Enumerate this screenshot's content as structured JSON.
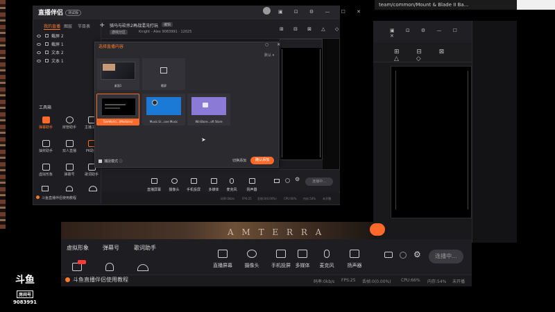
{
  "background": {
    "address_text": "team/common/Mount & Blade II Ba...",
    "banner_text": "A M T E R R A"
  },
  "back_window": {
    "tools_left": [
      "虚拟形象",
      "弹幕号",
      "歌词助手"
    ],
    "toolbar": [
      {
        "label": "直播屏幕",
        "icon": "screen-icon"
      },
      {
        "label": "摄像头",
        "icon": "camera-icon"
      },
      {
        "label": "手机投屏",
        "icon": "phone-icon"
      },
      {
        "label": "多媒体",
        "icon": "media-icon"
      },
      {
        "label": "麦克风",
        "icon": "mic-icon"
      },
      {
        "label": "扬声器",
        "icon": "speaker-icon"
      }
    ],
    "live_button": "连播中...",
    "notice": "斗鱼直播伴侣使用教程",
    "status": {
      "bitrate": "码率:0kb/s",
      "fps": "FPS:25",
      "dropped": "丢帧:0(0.00%)",
      "cpu": "CPU:66%",
      "memory": "内存:54%",
      "extra": "未开播"
    }
  },
  "main_window": {
    "logo": "直播伴侣",
    "version_badge": "测试版",
    "left_tabs": [
      "我的直播",
      "图层",
      "节目表"
    ],
    "layers": [
      {
        "name": "截屏 2"
      },
      {
        "name": "截屏 1"
      },
      {
        "name": "文本 2"
      },
      {
        "name": "文本 1"
      }
    ],
    "tools_title": "工具箱",
    "tools": [
      {
        "label": "弹幕助手",
        "active": true
      },
      {
        "label": "房管助手",
        "active": false
      },
      {
        "label": "主播工具",
        "active": false
      },
      {
        "label": "抽奖助手",
        "active": false
      },
      {
        "label": "双人直播",
        "active": false
      },
      {
        "label": "PK助手",
        "active": false
      },
      {
        "label": "虚拟形象",
        "active": false
      },
      {
        "label": "弹幕号",
        "active": false
      },
      {
        "label": "歌词助手",
        "active": false
      }
    ],
    "room_title": "骑马与砍杀2再战混沌打玩",
    "edit_tag": "编辑",
    "room_tag": "游戏分区",
    "room_meta": "Knight - Alex 9083991 · 12025",
    "bottom_tools": [
      "直播屏幕",
      "摄像头",
      "手机投屏",
      "多媒体",
      "麦克风",
      "扬声器"
    ],
    "live_button": "连播中...",
    "notice": "斗鱼直播伴侣使用教程",
    "status": [
      "码率:0kb/s",
      "FPS:25",
      "丢帧:0(0.00%)",
      "CPU:66%",
      "内存:54%",
      "未开播"
    ]
  },
  "modal": {
    "title": "选择直播内容",
    "filter_label": "默认",
    "sources": [
      {
        "name": "桌面1",
        "selected": false,
        "thumb": "dark"
      },
      {
        "name": "截屏",
        "selected": false,
        "thumb": "icon"
      },
      {
        "name": "TaleWorld...(Modules)",
        "selected": true,
        "thumb": "black"
      },
      {
        "name": "Music.Ui...ove Music",
        "selected": false,
        "thumb": "blue"
      },
      {
        "name": "WinStore...oft Store",
        "selected": false,
        "thumb": "purple"
      }
    ],
    "checkbox_label": "捕捉模式 ⓘ",
    "cancel_label": "切换添加",
    "confirm_label": "确认添加"
  },
  "watermark": {
    "logo": "斗鱼",
    "room_label": "房间号",
    "room_number": "9083991"
  },
  "colors": {
    "accent": "#ff6a2a",
    "panel": "#1c1c20",
    "modal": "#2a2a2f"
  }
}
